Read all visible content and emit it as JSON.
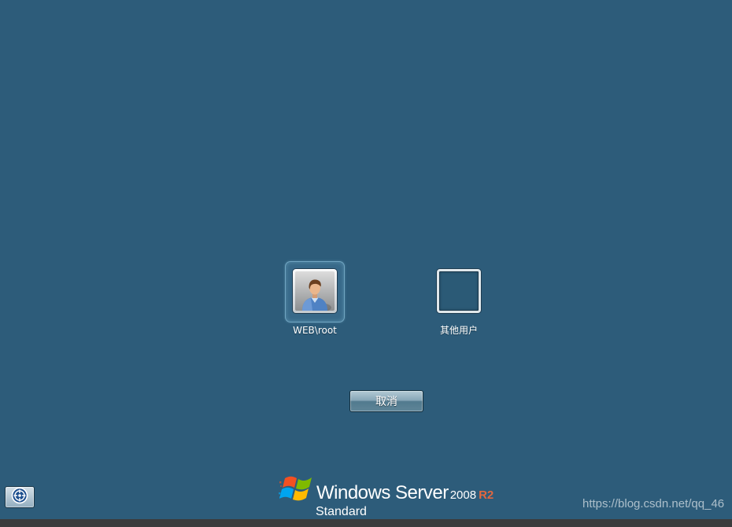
{
  "user_tiles": [
    {
      "label": "WEB\\root",
      "selected": true,
      "avatar_icon": "user-avatar-icon"
    },
    {
      "label": "其他用户",
      "selected": false
    }
  ],
  "cancel_button": {
    "label": "取消"
  },
  "ease_of_access": {
    "icon": "ease-of-access-icon"
  },
  "branding": {
    "logo_icon": "windows-flag-icon",
    "product": "Windows Server",
    "version": "2008",
    "release": "R2",
    "edition": "Standard"
  },
  "watermark": "https://blog.csdn.net/qq_46",
  "colors": {
    "background": "#2d5c7a",
    "release_accent": "#e2673f",
    "bottom_bar": "#3b3c3d"
  }
}
